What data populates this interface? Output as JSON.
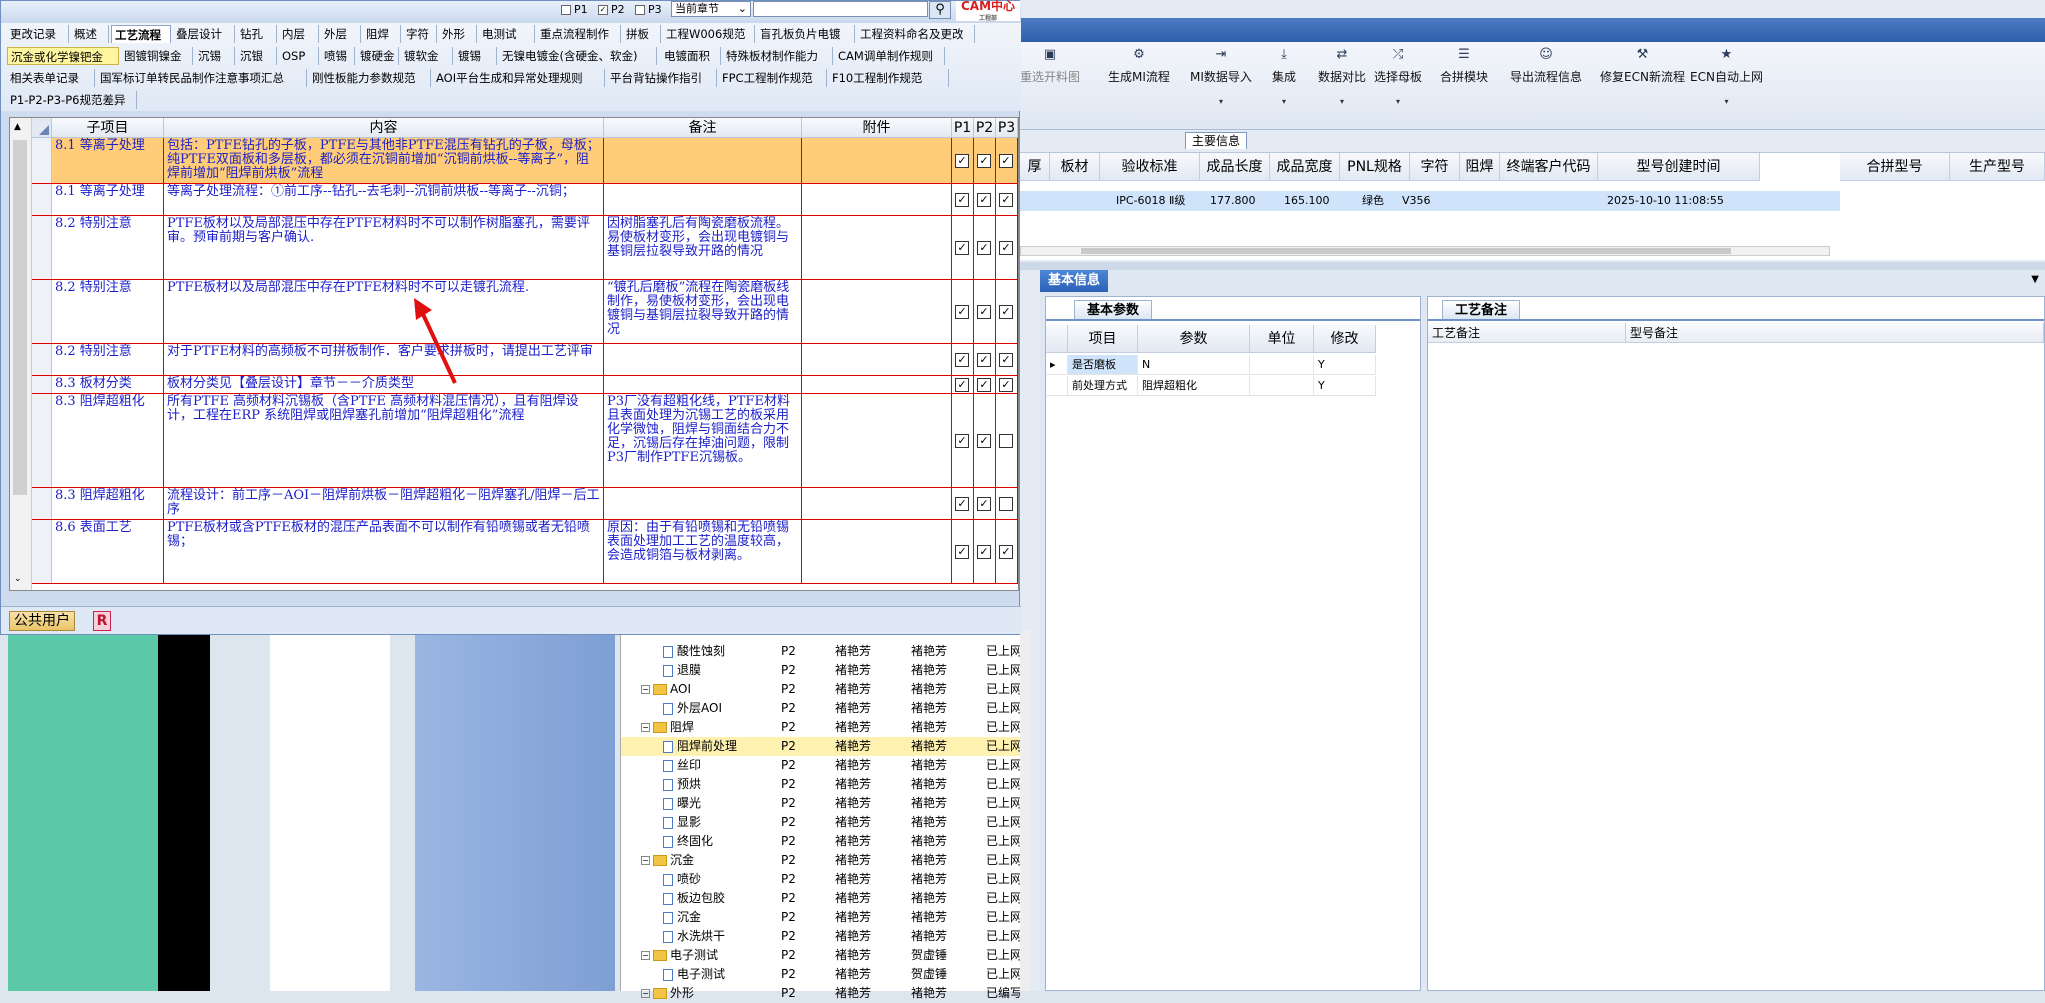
{
  "bg_toolbar": {
    "buttons": [
      {
        "label": "重选开料图",
        "icon": "image-icon",
        "disabled": true,
        "dropdown": false
      },
      {
        "label": "生成MI流程",
        "icon": "gears-icon",
        "disabled": false,
        "dropdown": false
      },
      {
        "label": "MI数据导入",
        "icon": "import-icon",
        "disabled": false,
        "dropdown": true
      },
      {
        "label": "集成",
        "icon": "download-icon",
        "disabled": false,
        "dropdown": true
      },
      {
        "label": "数据对比",
        "icon": "compare-icon",
        "disabled": false,
        "dropdown": true
      },
      {
        "label": "选择母板",
        "icon": "shuffle-icon",
        "disabled": false,
        "dropdown": true
      },
      {
        "label": "合拼模块",
        "icon": "list-icon",
        "disabled": false,
        "dropdown": false
      },
      {
        "label": "导出流程信息",
        "icon": "smile-icon",
        "disabled": false,
        "dropdown": false
      },
      {
        "label": "修复ECN新流程",
        "icon": "wrench-icon",
        "disabled": false,
        "dropdown": false
      },
      {
        "label": "ECN自动上网",
        "icon": "star-icon",
        "disabled": false,
        "dropdown": true
      }
    ]
  },
  "main_info": {
    "label": "主要信息",
    "headers": [
      "厚",
      "板材",
      "验收标准",
      "成品长度",
      "成品宽度",
      "PNL规格",
      "字符",
      "阻焊",
      "终端客户代码",
      "型号创建时间",
      "合拼型号",
      "生产型号"
    ],
    "row": {
      "standard": "IPC-6018 Ⅱ级",
      "length": "177.800",
      "width": "165.100",
      "mask": "绿色",
      "customer": "V356",
      "created": "2025-10-10 11:08:55"
    }
  },
  "basic_info": {
    "title": "基本信息",
    "params_tab": "基本参数",
    "notes_tab": "工艺备注",
    "params_headers": [
      "项目",
      "参数",
      "单位",
      "修改"
    ],
    "params_rows": [
      {
        "item": "是否磨板",
        "param": "N",
        "unit": "",
        "edit": "Y"
      },
      {
        "item": "前处理方式",
        "param": "阻焊超粗化",
        "unit": "",
        "edit": "Y"
      }
    ],
    "notes_headers": [
      "工艺备注",
      "型号备注"
    ]
  },
  "tree": {
    "rows": [
      {
        "label": "酸性蚀刻",
        "type": "doc",
        "c1": "P2",
        "c2": "褚艳芳",
        "c3": "褚艳芳",
        "c4": "已上网",
        "selected": false
      },
      {
        "label": "退膜",
        "type": "doc",
        "c1": "P2",
        "c2": "褚艳芳",
        "c3": "褚艳芳",
        "c4": "已上网",
        "selected": false
      },
      {
        "label": "AOI",
        "type": "folder",
        "c1": "P2",
        "c2": "褚艳芳",
        "c3": "褚艳芳",
        "c4": "已上网",
        "selected": false
      },
      {
        "label": "外层AOI",
        "type": "doc",
        "c1": "P2",
        "c2": "褚艳芳",
        "c3": "褚艳芳",
        "c4": "已上网",
        "selected": false
      },
      {
        "label": "阻焊",
        "type": "folder",
        "c1": "P2",
        "c2": "褚艳芳",
        "c3": "褚艳芳",
        "c4": "已上网",
        "selected": false
      },
      {
        "label": "阻焊前处理",
        "type": "doc",
        "c1": "P2",
        "c2": "褚艳芳",
        "c3": "褚艳芳",
        "c4": "已上网",
        "selected": true
      },
      {
        "label": "丝印",
        "type": "doc",
        "c1": "P2",
        "c2": "褚艳芳",
        "c3": "褚艳芳",
        "c4": "已上网",
        "selected": false
      },
      {
        "label": "预烘",
        "type": "doc",
        "c1": "P2",
        "c2": "褚艳芳",
        "c3": "褚艳芳",
        "c4": "已上网",
        "selected": false
      },
      {
        "label": "曝光",
        "type": "doc",
        "c1": "P2",
        "c2": "褚艳芳",
        "c3": "褚艳芳",
        "c4": "已上网",
        "selected": false
      },
      {
        "label": "显影",
        "type": "doc",
        "c1": "P2",
        "c2": "褚艳芳",
        "c3": "褚艳芳",
        "c4": "已上网",
        "selected": false
      },
      {
        "label": "终固化",
        "type": "doc",
        "c1": "P2",
        "c2": "褚艳芳",
        "c3": "褚艳芳",
        "c4": "已上网",
        "selected": false
      },
      {
        "label": "沉金",
        "type": "folder",
        "c1": "P2",
        "c2": "褚艳芳",
        "c3": "褚艳芳",
        "c4": "已上网",
        "selected": false
      },
      {
        "label": "喷砂",
        "type": "doc",
        "c1": "P2",
        "c2": "褚艳芳",
        "c3": "褚艳芳",
        "c4": "已上网",
        "selected": false
      },
      {
        "label": "板边包胶",
        "type": "doc",
        "c1": "P2",
        "c2": "褚艳芳",
        "c3": "褚艳芳",
        "c4": "已上网",
        "selected": false
      },
      {
        "label": "沉金",
        "type": "doc",
        "c1": "P2",
        "c2": "褚艳芳",
        "c3": "褚艳芳",
        "c4": "已上网",
        "selected": false
      },
      {
        "label": "水洗烘干",
        "type": "doc",
        "c1": "P2",
        "c2": "褚艳芳",
        "c3": "褚艳芳",
        "c4": "已上网",
        "selected": false
      },
      {
        "label": "电子测试",
        "type": "folder",
        "c1": "P2",
        "c2": "褚艳芳",
        "c3": "贺虚锤",
        "c4": "已上网",
        "selected": false
      },
      {
        "label": "电子测试",
        "type": "doc",
        "c1": "P2",
        "c2": "褚艳芳",
        "c3": "贺虚锤",
        "c4": "已上网",
        "selected": false
      },
      {
        "label": "外形",
        "type": "folder",
        "c1": "P2",
        "c2": "褚艳芳",
        "c3": "褚艳芳",
        "c4": "已编写",
        "selected": false
      }
    ]
  },
  "popup": {
    "top": {
      "p1": "P1",
      "p2": "P2",
      "p3": "P3",
      "chapter": "当前章节",
      "logo_line1": "CAM中心",
      "logo_line2": "工程部"
    },
    "tabs_row1": [
      "更改记录",
      "概述",
      "工艺流程",
      "叠层设计",
      "钻孔",
      "内层",
      "外层",
      "阻焊",
      "字符",
      "外形",
      "电测试",
      "重点流程制作",
      "拼板",
      "工程W006规范",
      "盲孔板负片电镀",
      "工程资料命名及更改"
    ],
    "tabs_row2": [
      "沉金或化学镍钯金",
      "图镀铜镍金",
      "沉锡",
      "沉银",
      "OSP",
      "喷锡",
      "镀硬金",
      "镀软金",
      "镀锡",
      "无镍电镀金(含硬金、软金)",
      "电镀面积",
      "特殊板材制作能力",
      "CAM调单制作规则"
    ],
    "tabs_row3": [
      "相关表单记录",
      "国军标订单转民品制作注意事项汇总",
      "刚性板能力参数规范",
      "AOI平台生成和异常处理规则",
      "平台背钻操作指引",
      "FPC工程制作规范",
      "F10工程制作规范"
    ],
    "tabs_row4": [
      "P1-P2-P3-P6规范差异"
    ],
    "grid_headers": [
      "子项目",
      "内容",
      "备注",
      "附件",
      "P1",
      "P2",
      "P3"
    ],
    "grid_rows": [
      {
        "sub": "8.1 等离子处理",
        "content": "包括：PTFE钻孔的子板，PTFE与其他非PTFE混压有钻孔的子板，母板；纯PTFE双面板和多层板，都必须在沉铜前增加“沉铜前烘板--等离子”，阻焊前增加“阻焊前烘板”流程",
        "note": "",
        "attach": "",
        "p1": true,
        "p2": true,
        "p3": true
      },
      {
        "sub": "8.1 等离子处理",
        "content": "等离子处理流程：①前工序--钻孔--去毛刺--沉铜前烘板--等离子--沉铜；",
        "note": "",
        "attach": "",
        "p1": true,
        "p2": true,
        "p3": true
      },
      {
        "sub": "8.2 特别注意",
        "content": "PTFE板材以及局部混压中存在PTFE材料时不可以制作树脂塞孔，需要评审。预审前期与客户确认.",
        "note": "因树脂塞孔后有陶瓷磨板流程。易使板材变形，会出现电镀铜与基铜层拉裂导致开路的情况",
        "attach": "",
        "p1": true,
        "p2": true,
        "p3": true
      },
      {
        "sub": "8.2 特别注意",
        "content": "PTFE板材以及局部混压中存在PTFE材料时不可以走镀孔流程.",
        "note": "“镀孔后磨板”流程在陶瓷磨板线制作，易使板材变形，会出现电镀铜与基铜层拉裂导致开路的情况",
        "attach": "",
        "p1": true,
        "p2": true,
        "p3": true
      },
      {
        "sub": "8.2 特别注意",
        "content": "对于PTFE材料的高频板不可拼板制作．客户要求拼板时，请提出工艺评审",
        "note": "",
        "attach": "",
        "p1": true,
        "p2": true,
        "p3": true
      },
      {
        "sub": "8.3 板材分类",
        "content": "板材分类见【叠层设计】章节－－介质类型",
        "note": "",
        "attach": "",
        "p1": true,
        "p2": true,
        "p3": true
      },
      {
        "sub": "8.3 阻焊超粗化",
        "content": "所有PTFE 高频材料沉锡板（含PTFE 高频材料混压情况），且有阻焊设计，工程在ERP 系统阻焊或阻焊塞孔前增加“阻焊超粗化”流程",
        "note": "P3厂没有超粗化线，PTFE材料且表面处理为沉锡工艺的板采用化学微蚀，阻焊与铜面结合力不足，沉锡后存在掉油问题，限制P3厂制作PTFE沉锡板。",
        "attach": "",
        "p1": true,
        "p2": true,
        "p3": false
      },
      {
        "sub": "8.3 阻焊超粗化",
        "content": "流程设计：前工序－AOI－阻焊前烘板－阻焊超粗化－阻焊塞孔/阻焊－后工序",
        "note": "",
        "attach": "",
        "p1": true,
        "p2": true,
        "p3": false
      },
      {
        "sub": "8.6 表面工艺",
        "content": "PTFE板材或含PTFE板材的混压产品表面不可以制作有铅喷锡或者无铅喷锡；",
        "note": "原因：由于有铅喷锡和无铅喷锡表面处理加工工艺的温度较高，会造成铜箔与板材剥离。",
        "attach": "",
        "p1": true,
        "p2": true,
        "p3": true
      }
    ],
    "bottom": {
      "user": "公共用户",
      "badge": "R"
    }
  }
}
